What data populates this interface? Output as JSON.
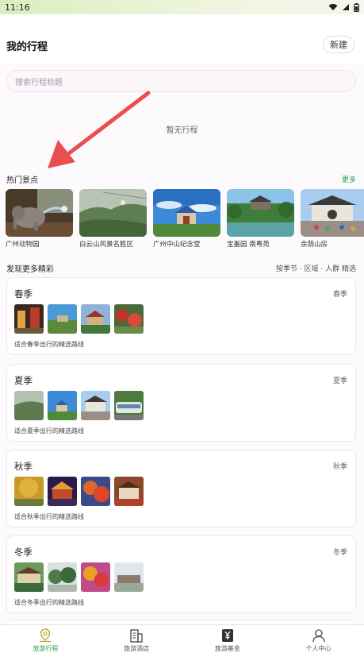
{
  "status_bar": {
    "time": "11:16"
  },
  "header": {
    "title": "我的行程",
    "new_label": "新建"
  },
  "search": {
    "placeholder": "搜索行程标题"
  },
  "empty_state": "暂无行程",
  "hot_spots": {
    "title": "热门景点",
    "more_label": "更多",
    "items": [
      {
        "label": "广州动物园",
        "icon": "elephant-photo"
      },
      {
        "label": "白云山风景名胜区",
        "icon": "mountain-photo"
      },
      {
        "label": "广州中山纪念堂",
        "icon": "memorial-hall-photo"
      },
      {
        "label": "宝墨园 南粤苑",
        "icon": "garden-photo"
      },
      {
        "label": "余荫山房",
        "icon": "pavilion-photo"
      }
    ]
  },
  "discover": {
    "title": "发现更多精彩",
    "filters": "按季节 · 区域 · 人群 精选"
  },
  "seasons": [
    {
      "name": "春季",
      "tag": "春季",
      "desc": "适合春季出行的精选路线"
    },
    {
      "name": "夏季",
      "tag": "夏季",
      "desc": "适合夏季出行的精选路线"
    },
    {
      "name": "秋季",
      "tag": "秋季",
      "desc": "适合秋季出行的精选路线"
    },
    {
      "name": "冬季",
      "tag": "冬季",
      "desc": "适合冬季出行的精选路线"
    }
  ],
  "bottom_nav": [
    {
      "label": "旅游行程",
      "icon": "map-pin-icon",
      "active": true
    },
    {
      "label": "旅游酒店",
      "icon": "building-icon",
      "active": false
    },
    {
      "label": "旅游基金",
      "icon": "yen-icon",
      "active": false
    },
    {
      "label": "个人中心",
      "icon": "person-icon",
      "active": false
    }
  ],
  "colors": {
    "accent": "#2e9b4a",
    "arrow": "#e8504f",
    "background": "#fdfafd"
  }
}
